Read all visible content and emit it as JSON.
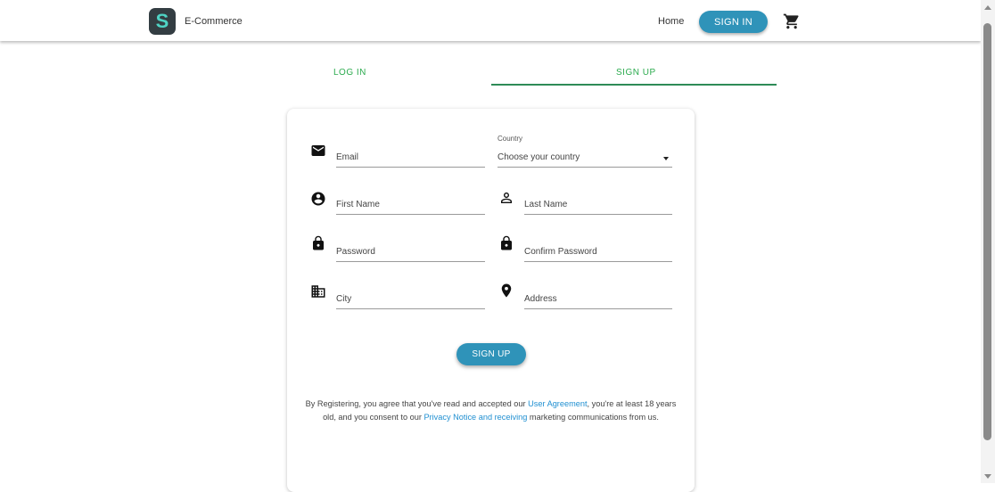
{
  "header": {
    "logo_letter": "S",
    "brand": "E-Commerce",
    "nav_home": "Home",
    "signin_button": "SIGN IN",
    "cart_icon": "shopping-cart-icon"
  },
  "tabs": [
    {
      "label": "LOG IN",
      "active": false
    },
    {
      "label": "SIGN UP",
      "active": true
    }
  ],
  "form": {
    "email": {
      "label": "Email",
      "icon": "envelope-icon"
    },
    "country": {
      "caption": "Country",
      "value": "Choose your country"
    },
    "first_name": {
      "label": "First Name",
      "icon": "account-circle-icon"
    },
    "last_name": {
      "label": "Last Name",
      "icon": "person-outline-icon"
    },
    "password": {
      "label": "Password",
      "icon": "lock-icon"
    },
    "confirm_password": {
      "label": "Confirm Password",
      "icon": "lock-icon"
    },
    "city": {
      "label": "City",
      "icon": "building-icon"
    },
    "address": {
      "label": "Address",
      "icon": "location-pin-icon"
    },
    "submit": "SIGN UP"
  },
  "legal": {
    "text1": "By Registering, you agree that you've read and accepted our ",
    "link1": "User Agreement",
    "text2": ", you're at least 18 years old, and you consent to our ",
    "link2": "Privacy Notice and receiving",
    "text3": " marketing communications from us."
  },
  "colors": {
    "primary_button": "#2f93b9",
    "tab_text": "#2cab4f",
    "tab_indicator": "#2e8b57",
    "link": "#1f8fd1"
  }
}
